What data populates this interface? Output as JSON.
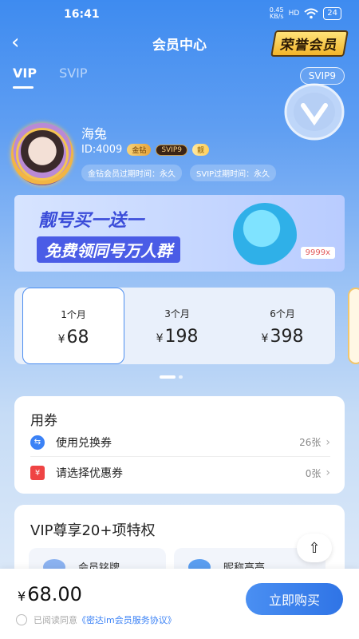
{
  "status_bar": {
    "time": "16:41",
    "net_speed_value": "0.45",
    "net_speed_unit": "KB/s",
    "signal": "HD",
    "battery": "24"
  },
  "header": {
    "title": "会员中心",
    "badge": "荣誉会员"
  },
  "tabs": [
    {
      "label": "VIP",
      "active": true
    },
    {
      "label": "SVIP",
      "active": false
    }
  ],
  "level_chip": "SVIP9",
  "profile": {
    "name": "海兔",
    "id": "ID:4009",
    "badge_gold": "金钻",
    "badge_svip": "SVIP9",
    "badge_gem": "靓",
    "expire_gold": "金钻会员过期时间：永久",
    "expire_svip": "SVIP过期时间：永久"
  },
  "banner": {
    "line1": "靓号买一送一",
    "line2": "免费领同号万人群",
    "tag": "9999x"
  },
  "plans": [
    {
      "duration": "1个月",
      "price": "68",
      "selected": true
    },
    {
      "duration": "3个月",
      "price": "198",
      "selected": false
    },
    {
      "duration": "6个月",
      "price": "398",
      "selected": false
    }
  ],
  "currency": "¥",
  "coupons": {
    "title": "用券",
    "exchange_label": "使用兑换券",
    "exchange_count": "26张",
    "discount_label": "请选择优惠券",
    "discount_count": "0张"
  },
  "privileges": {
    "title": "VIP尊享20+项特权",
    "items": [
      "会员铭牌",
      "昵称高亮"
    ]
  },
  "bottom": {
    "total": "68.00",
    "buy_label": "立即购买",
    "agree_text": "已阅读同意",
    "agree_link": "《密达im会员服务协议》"
  },
  "colors": {
    "accent": "#3b82f6",
    "gold": "#f3b52a"
  }
}
